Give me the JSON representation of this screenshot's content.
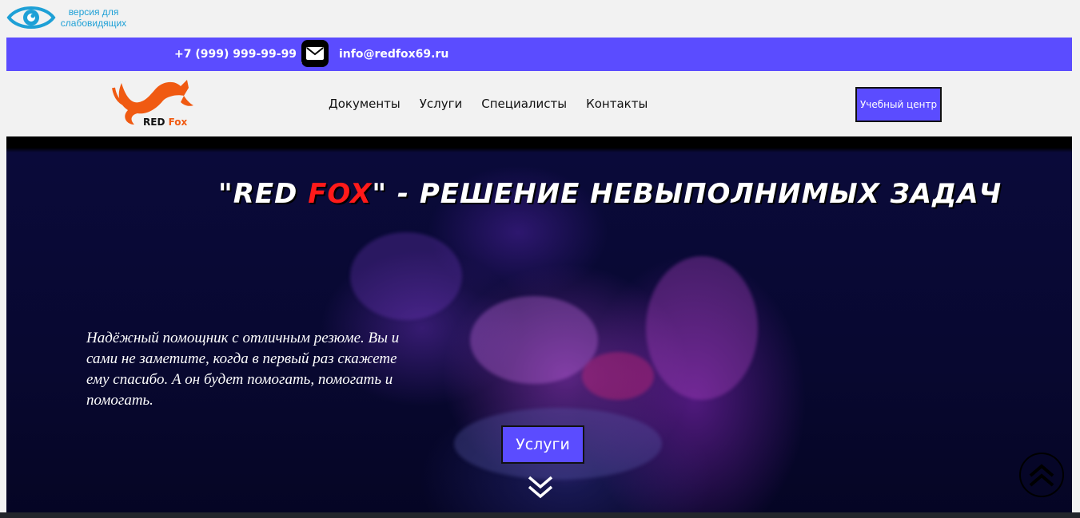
{
  "accessibility": {
    "label": "версия для слабовидящих",
    "icon": "eye-icon"
  },
  "contact_bar": {
    "phone": "+7 (999) 999-99-99",
    "email": "info@redfox69.ru",
    "mail_icon": "envelope-icon",
    "background": "#5b4cff"
  },
  "logo": {
    "red": "RED",
    "fox": "Fox",
    "icon": "fox-icon"
  },
  "nav": {
    "items": [
      "Документы",
      "Услуги",
      "Специалисты",
      "Контакты"
    ]
  },
  "edu_button": {
    "label": "Учебный центр"
  },
  "hero": {
    "title_prefix": "\"RED ",
    "title_fox": "FOX",
    "title_suffix": "\" - РЕШЕНИЕ НЕВЫПОЛНИМЫХ ЗАДАЧ",
    "description": "Надёжный помощник с отличным резюме. Вы и сами не заметите, когда в первый раз скажете ему спасибо. А он будет помогать, помогать и помогать.",
    "button": "Услуги",
    "down_icon": "double-chevron-down-icon",
    "top_icon": "double-chevron-up-icon"
  },
  "colors": {
    "accent": "#5b4cff",
    "brand_orange": "#f05a12",
    "title_red": "#ff1a1a"
  }
}
